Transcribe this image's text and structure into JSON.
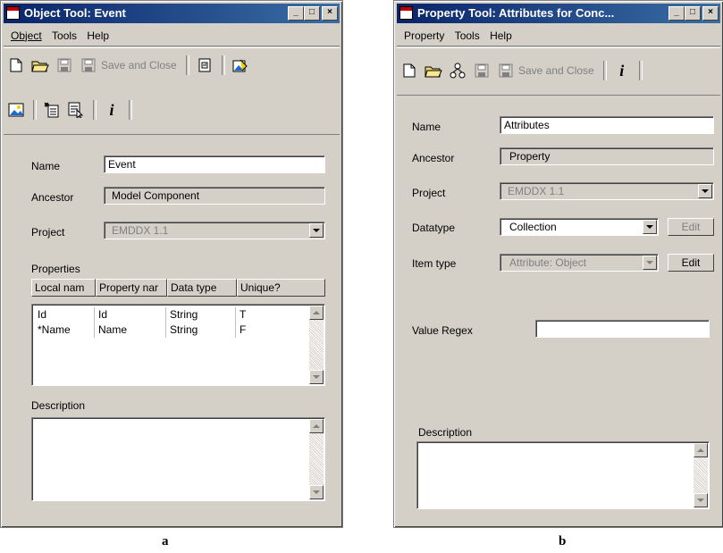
{
  "left_window": {
    "title": "Object Tool: Event",
    "menu": [
      "Object",
      "Tools",
      "Help"
    ],
    "menu_underline": [
      "O",
      "T",
      "H"
    ],
    "toolbar": {
      "save_and_close_label": "Save and Close"
    },
    "fields": {
      "name_label": "Name",
      "name_value": "Event",
      "ancestor_label": "Ancestor",
      "ancestor_value": "Model Component",
      "project_label": "Project",
      "project_value": "EMDDX 1.1"
    },
    "properties_label": "Properties",
    "table": {
      "columns": [
        "Local nam",
        "Property nar",
        "Data type",
        "Unique?"
      ],
      "rows": [
        [
          "Id",
          "Id",
          "String",
          "T"
        ],
        [
          "*Name",
          "Name",
          "String",
          "F"
        ]
      ]
    },
    "description_label": "Description",
    "caption": "a"
  },
  "right_window": {
    "title": "Property Tool: Attributes for Conc...",
    "menu": [
      "Property",
      "Tools",
      "Help"
    ],
    "toolbar": {
      "save_and_close_label": "Save and Close"
    },
    "fields": {
      "name_label": "Name",
      "name_value": "Attributes",
      "ancestor_label": "Ancestor",
      "ancestor_value": "Property",
      "project_label": "Project",
      "project_value": "EMDDX 1.1",
      "datatype_label": "Datatype",
      "datatype_value": "Collection",
      "itemtype_label": "Item type",
      "itemtype_value": "Attribute: Object",
      "value_regex_label": "Value Regex",
      "value_regex_value": ""
    },
    "edit_label": "Edit",
    "description_label": "Description",
    "caption": "b"
  },
  "colors": {
    "titlebar_start": "#0a246a",
    "titlebar_end": "#3a6ea5",
    "window_bg": "#d4d0c8"
  }
}
